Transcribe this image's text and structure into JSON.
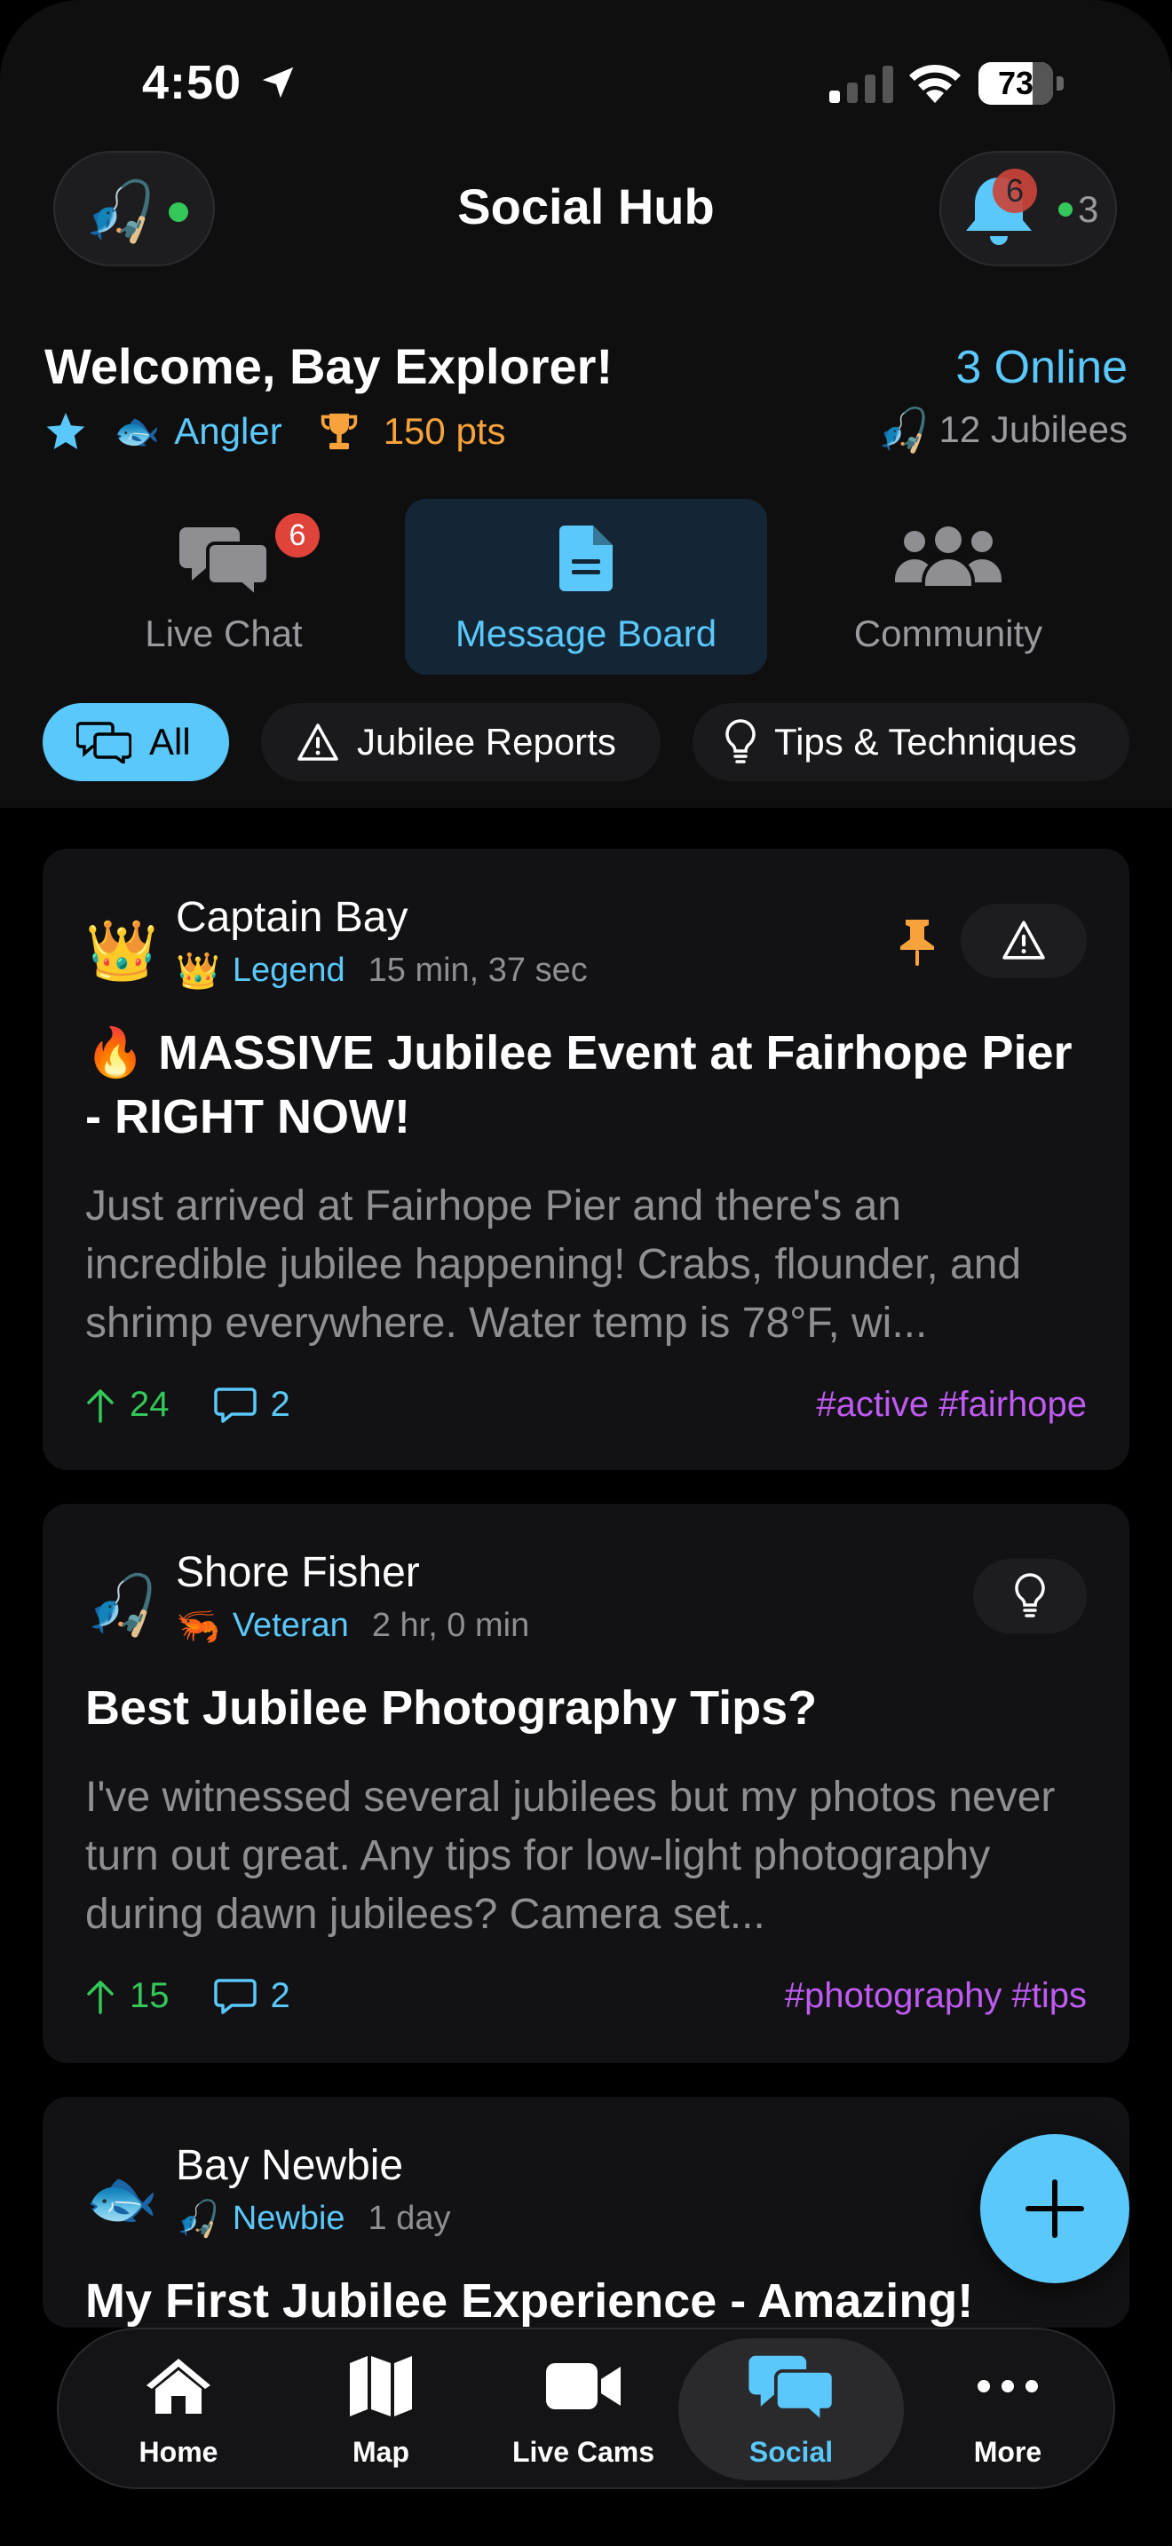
{
  "status_bar": {
    "time": "4:50",
    "battery": "73",
    "battery_level": 0.73
  },
  "header": {
    "title": "Social Hub",
    "avatar_emoji": "🎣",
    "notification_badge": "6",
    "online_users": "3"
  },
  "welcome": {
    "greeting": "Welcome, Bay Explorer!",
    "rank_emoji": "🐟",
    "rank": "Angler",
    "points": "150 pts",
    "online_count": "3 Online",
    "jubilees_emoji": "🎣",
    "jubilees": "12 Jubilees"
  },
  "main_tabs": [
    {
      "label": "Live Chat",
      "badge": "6",
      "icon": "chat-bubbles-icon"
    },
    {
      "label": "Message Board",
      "icon": "document-icon",
      "active": true
    },
    {
      "label": "Community",
      "icon": "people-icon"
    }
  ],
  "filters": [
    {
      "label": "All",
      "icon": "chat-bubbles-icon",
      "active": true
    },
    {
      "label": "Jubilee Reports",
      "icon": "warning-icon"
    },
    {
      "label": "Tips & Techniques",
      "icon": "lightbulb-icon"
    }
  ],
  "posts": [
    {
      "avatar": "👑",
      "author": "Captain Bay",
      "rank_emoji": "👑",
      "rank": "Legend",
      "time": "15 min, 37 sec",
      "pinned": true,
      "type_icon": "warning-icon",
      "title": "🔥 MASSIVE Jubilee Event at Fairhope Pier - RIGHT NOW!",
      "body": "Just arrived at Fairhope Pier and there's an incredible jubilee happening! Crabs, flounder, and shrimp everywhere. Water temp is 78°F, wi...",
      "upvotes": "24",
      "comments": "2",
      "tags": "#active #fairhope"
    },
    {
      "avatar": "🎣",
      "author": "Shore Fisher",
      "rank_emoji": "🦐",
      "rank": "Veteran",
      "time": "2 hr, 0 min",
      "type_icon": "lightbulb-icon",
      "title": "Best Jubilee Photography Tips?",
      "body": "I've witnessed several jubilees but my photos never turn out great. Any tips for low-light photography during dawn jubilees? Camera set...",
      "upvotes": "15",
      "comments": "2",
      "tags": "#photography #tips"
    },
    {
      "avatar": "🐟",
      "author": "Bay Newbie",
      "rank_emoji": "🎣",
      "rank": "Newbie",
      "time": "1 day",
      "title": "My First Jubilee Experience - Amazing!"
    }
  ],
  "tabbar": [
    {
      "label": "Home",
      "icon": "home-icon"
    },
    {
      "label": "Map",
      "icon": "map-icon"
    },
    {
      "label": "Live Cams",
      "icon": "video-icon"
    },
    {
      "label": "Social",
      "icon": "chat-bubbles-icon",
      "active": true
    },
    {
      "label": "More",
      "icon": "ellipsis-icon"
    }
  ],
  "colors": {
    "accent": "#5ac8fa",
    "points": "#f7a23b",
    "tags": "#bf5af2",
    "upvote": "#34c759",
    "badge": "#e0433a"
  }
}
